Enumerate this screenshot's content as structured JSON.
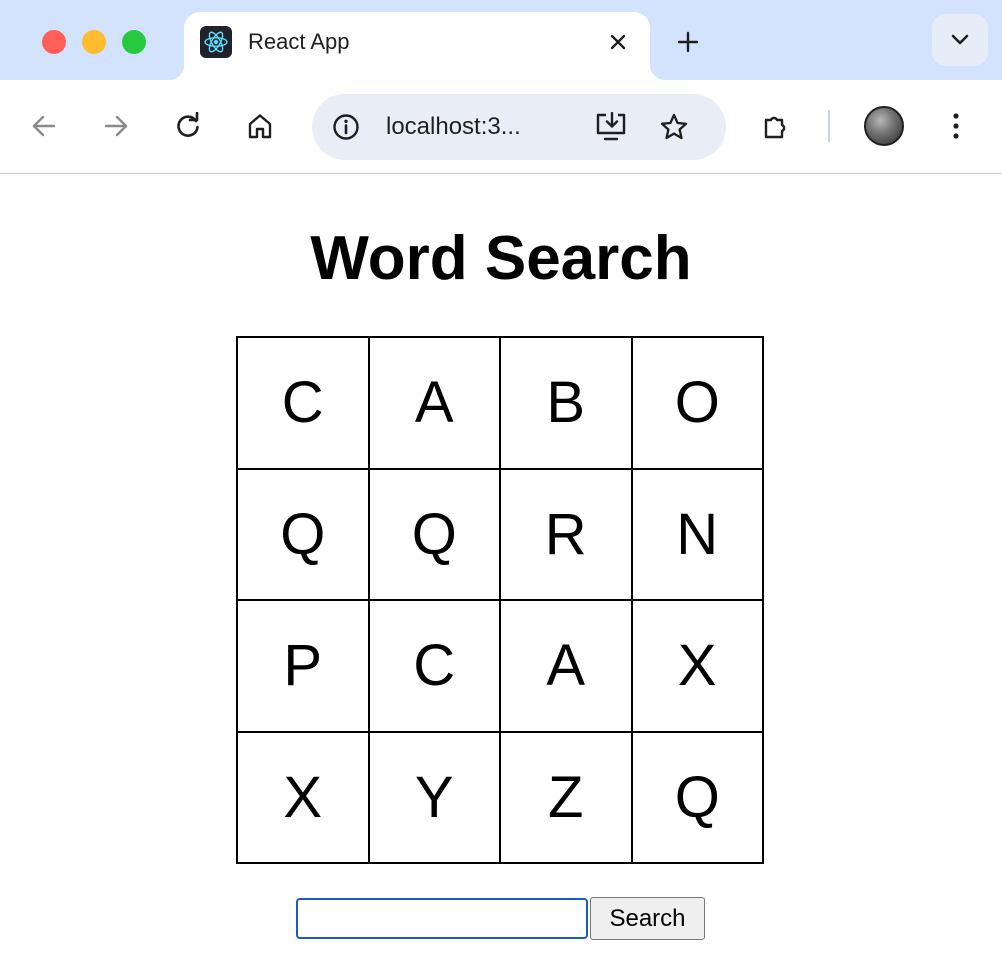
{
  "browser": {
    "tab": {
      "title": "React App",
      "favicon": "react-logo-icon"
    },
    "omnibox": {
      "url": "localhost:3..."
    },
    "icons": [
      "back-icon",
      "forward-icon",
      "reload-icon",
      "home-icon",
      "info-icon",
      "install-app-icon",
      "star-icon",
      "extensions-icon",
      "avatar",
      "kebab-menu-icon",
      "new-tab-icon",
      "tab-search-icon",
      "close-icon"
    ],
    "colors": {
      "tabstrip": "#d3e3fd",
      "omnibox": "#e9eef6"
    }
  },
  "page": {
    "title": "Word Search",
    "grid": [
      [
        "C",
        "A",
        "B",
        "O"
      ],
      [
        "Q",
        "Q",
        "R",
        "N"
      ],
      [
        "P",
        "C",
        "A",
        "X"
      ],
      [
        "X",
        "Y",
        "Z",
        "Q"
      ]
    ],
    "search": {
      "value": "",
      "button_label": "Search"
    }
  }
}
